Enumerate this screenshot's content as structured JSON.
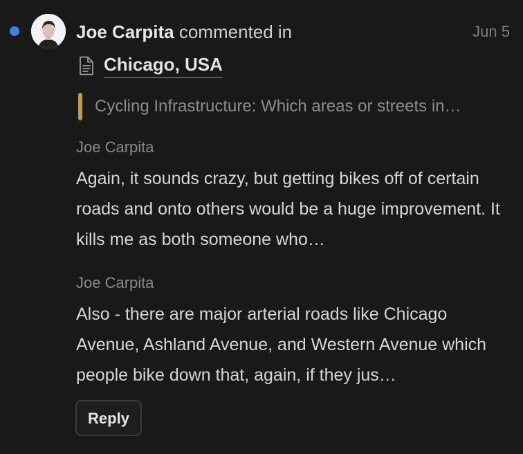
{
  "notification": {
    "author": "Joe Carpita",
    "action": "commented in",
    "date": "Jun 5",
    "unread_color": "#3e82e4"
  },
  "page": {
    "icon": "page-icon",
    "title": "Chicago, USA"
  },
  "quote": {
    "text": "Cycling Infrastructure: Which areas or streets in…",
    "accent_color": "#c29a3f"
  },
  "comments": [
    {
      "author": "Joe Carpita",
      "body": "Again, it sounds crazy, but getting bikes off of certain roads and onto others would be a huge improvement. It kills me as both someone who…"
    },
    {
      "author": "Joe Carpita",
      "body": "Also - there are major arterial roads like Chicago Avenue, Ashland Avenue, and Western Avenue which people bike down that, again, if they jus…"
    }
  ],
  "reply": {
    "label": "Reply"
  }
}
